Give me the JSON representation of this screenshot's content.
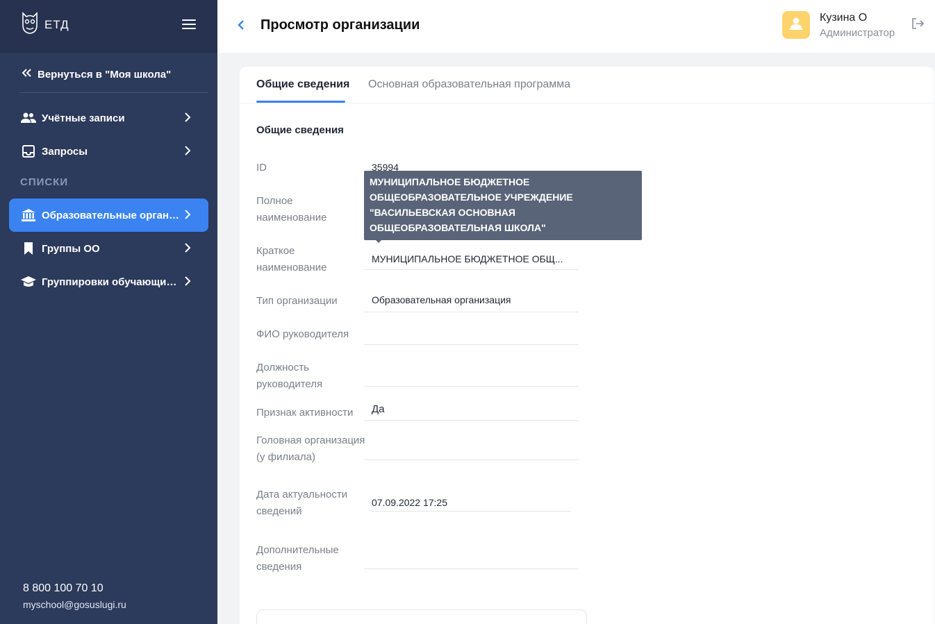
{
  "sidebar": {
    "logo_text": "ЕТД",
    "back_label": "Вернуться в \"Моя школа\"",
    "items": [
      {
        "label": "Учётные записи",
        "icon": "users-icon"
      },
      {
        "label": "Запросы",
        "icon": "inbox-icon"
      }
    ],
    "section_label": "СПИСКИ",
    "list_items": [
      {
        "label": "Образовательные организации",
        "icon": "institution-icon",
        "active": true
      },
      {
        "label": "Группы ОО",
        "icon": "bookmark-icon"
      },
      {
        "label": "Группировки обучающихся",
        "icon": "graduation-cap-icon"
      }
    ],
    "phone": "8 800 100 70 10",
    "email": "myschool@gosuslugi.ru"
  },
  "header": {
    "title": "Просмотр организации",
    "user_name": "Кузина О",
    "user_role": "Администратор"
  },
  "tabs": [
    {
      "label": "Общие сведения",
      "active": true
    },
    {
      "label": "Основная образовательная программа",
      "active": false
    }
  ],
  "section_title": "Общие сведения",
  "fields": {
    "id": {
      "label": "ID",
      "value": "35994"
    },
    "full_name": {
      "label": "Полное наименование",
      "value": ""
    },
    "short_name": {
      "label": "Краткое наименование",
      "value": "МУНИЦИПАЛЬНОЕ БЮДЖЕТНОЕ ОБЩ..."
    },
    "org_type": {
      "label": "Тип организации",
      "value": "Образовательная организация"
    },
    "head_fio": {
      "label": "ФИО руководителя",
      "value": ""
    },
    "head_position": {
      "label": "Должность руководителя",
      "value": ""
    },
    "active": {
      "label": "Признак активности",
      "value": "Да"
    },
    "parent_org": {
      "label": "Головная организация (у филиала)",
      "value": ""
    },
    "relevance_date": {
      "label": "Дата актуальности сведений",
      "value": "07.09.2022 17:25"
    },
    "additional": {
      "label": "Дополнительные сведения",
      "value": ""
    }
  },
  "tooltip": {
    "text": "МУНИЦИПАЛЬНОЕ БЮДЖЕТНОЕ ОБЩЕОБРАЗОВАТЕЛЬНОЕ УЧРЕЖДЕНИЕ \"ВАСИЛЬЕВСКАЯ ОСНОВНАЯ ОБЩЕОБРАЗОВАТЕЛЬНАЯ ШКОЛА\""
  },
  "colors": {
    "sidebar_bg": "#2c3a5b",
    "accent": "#3a83f1",
    "avatar_bg": "#ffd36b",
    "tooltip_bg": "#5a6478"
  }
}
